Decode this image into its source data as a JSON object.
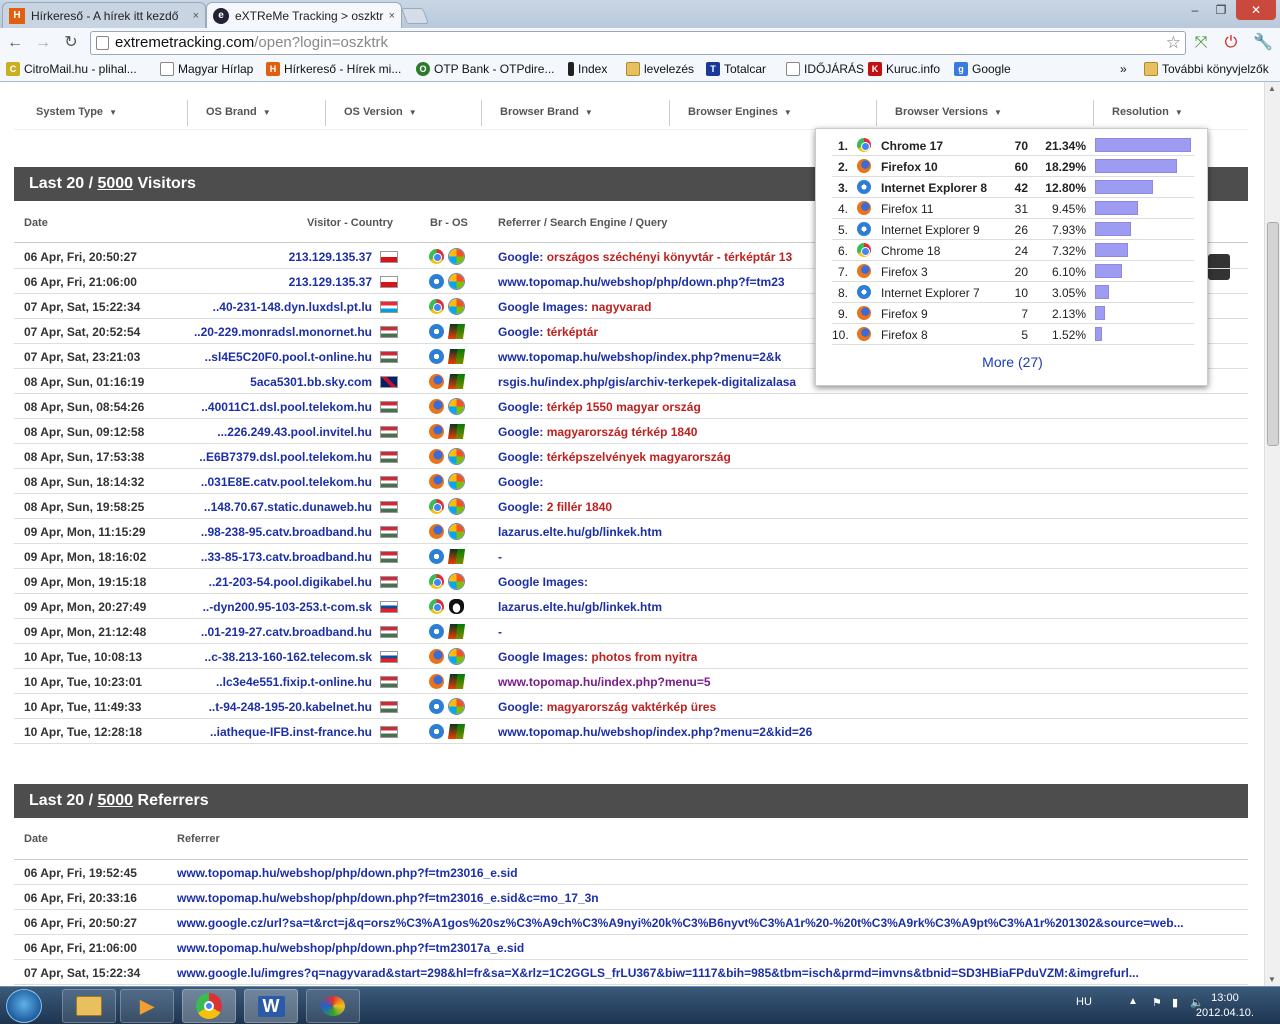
{
  "browser": {
    "tabs": [
      {
        "title": "Hírkereső - A hírek itt kezdő",
        "close": "×"
      },
      {
        "title": "eXTReMe Tracking > oszktr",
        "close": "×"
      }
    ],
    "window_controls": [
      "–",
      "❐",
      "✕"
    ],
    "url_host": "extremetracking.com",
    "url_path": "/open?login=oszktrk",
    "bookmarks": [
      {
        "label": "CitroMail.hu - plihal..."
      },
      {
        "label": "Magyar Hírlap"
      },
      {
        "label": "Hírkereső - Hírek mi..."
      },
      {
        "label": "OTP Bank - OTPdire..."
      },
      {
        "label": "Index"
      },
      {
        "label": "levelezés"
      },
      {
        "label": "Totalcar"
      },
      {
        "label": "IDŐJÁRÁS"
      },
      {
        "label": "Kuruc.info"
      },
      {
        "label": "Google"
      },
      {
        "label": "»"
      },
      {
        "label": "További könyvjelzők"
      }
    ]
  },
  "filters": [
    {
      "label": "System Type"
    },
    {
      "label": "OS Brand"
    },
    {
      "label": "OS Version"
    },
    {
      "label": "Browser Brand"
    },
    {
      "label": "Browser Engines"
    },
    {
      "label": "Browser Versions"
    },
    {
      "label": "Resolution"
    }
  ],
  "visitors": {
    "head_prefix": "Last 20 / ",
    "head_count": "5000",
    "head_suffix": " Visitors",
    "col_date": "Date",
    "col_visitor": "Visitor - Country",
    "col_bros": "Br - OS",
    "col_ref": "Referrer / Search Engine / Query",
    "rows": [
      {
        "date": "06 Apr, Fri, 20:50:27",
        "host": "213.129.135.37",
        "flag": "cz",
        "browser": "chrome",
        "os": "win7",
        "ref_a": "Google",
        "ref_b": ": ",
        "ref_q": "országos széchényi könyvtár - térképtár 13"
      },
      {
        "date": "06 Apr, Fri, 21:06:00",
        "host": "213.129.135.37",
        "flag": "cz",
        "browser": "ie",
        "os": "win7",
        "ref_a": "www.topomap.hu/webshop/php/down.php?f=tm23",
        "ref_b": "",
        "ref_q": ""
      },
      {
        "date": "07 Apr, Sat, 15:22:34",
        "host": "..40-231-148.dyn.luxdsl.pt.lu",
        "flag": "lu",
        "browser": "chrome",
        "os": "win7",
        "ref_a": "Google Images",
        "ref_b": ": ",
        "ref_q": "nagyvarad"
      },
      {
        "date": "07 Apr, Sat, 20:52:54",
        "host": "..20-229.monradsl.monornet.hu",
        "flag": "hu",
        "browser": "ie",
        "os": "xp",
        "ref_a": "Google",
        "ref_b": ": ",
        "ref_q": "térképtár"
      },
      {
        "date": "07 Apr, Sat, 23:21:03",
        "host": "..sl4E5C20F0.pool.t-online.hu",
        "flag": "hu",
        "browser": "ie",
        "os": "xp",
        "ref_a": "www.topomap.hu/webshop/index.php?menu=2&k",
        "ref_b": "",
        "ref_q": ""
      },
      {
        "date": "08 Apr, Sun, 01:16:19",
        "host": "5aca5301.bb.sky.com",
        "flag": "gb",
        "browser": "ff",
        "os": "xp",
        "ref_a": "rsgis.hu/index.php/gis/archiv-terkepek-digitalizalasa",
        "ref_b": "",
        "ref_q": ""
      },
      {
        "date": "08 Apr, Sun, 08:54:26",
        "host": "..40011C1.dsl.pool.telekom.hu",
        "flag": "hu",
        "browser": "ff",
        "os": "win7",
        "ref_a": "Google",
        "ref_b": ": ",
        "ref_q": "térkép 1550 magyar ország"
      },
      {
        "date": "08 Apr, Sun, 09:12:58",
        "host": "...226.249.43.pool.invitel.hu",
        "flag": "hu",
        "browser": "ff",
        "os": "xp",
        "ref_a": "Google",
        "ref_b": ": ",
        "ref_q": "magyarország térkép 1840"
      },
      {
        "date": "08 Apr, Sun, 17:53:38",
        "host": "..E6B7379.dsl.pool.telekom.hu",
        "flag": "hu",
        "browser": "ff",
        "os": "win7",
        "ref_a": "Google",
        "ref_b": ": ",
        "ref_q": "térképszelvények magyarország"
      },
      {
        "date": "08 Apr, Sun, 18:14:32",
        "host": "..031E8E.catv.pool.telekom.hu",
        "flag": "hu",
        "browser": "ff",
        "os": "win7",
        "ref_a": "Google",
        "ref_b": ":",
        "ref_q": ""
      },
      {
        "date": "08 Apr, Sun, 19:58:25",
        "host": "..148.70.67.static.dunaweb.hu",
        "flag": "hu",
        "browser": "chrome",
        "os": "win7",
        "ref_a": "Google",
        "ref_b": ": ",
        "ref_q": "2 fillér 1840"
      },
      {
        "date": "09 Apr, Mon, 11:15:29",
        "host": "..98-238-95.catv.broadband.hu",
        "flag": "hu",
        "browser": "ff",
        "os": "win7",
        "ref_a": "lazarus.elte.hu/gb/linkek.htm",
        "ref_b": "",
        "ref_q": ""
      },
      {
        "date": "09 Apr, Mon, 18:16:02",
        "host": "..33-85-173.catv.broadband.hu",
        "flag": "hu",
        "browser": "ie",
        "os": "xp",
        "ref_a": "",
        "ref_b": "-",
        "ref_q": ""
      },
      {
        "date": "09 Apr, Mon, 19:15:18",
        "host": "..21-203-54.pool.digikabel.hu",
        "flag": "hu",
        "browser": "chrome",
        "os": "win7",
        "ref_a": "Google Images",
        "ref_b": ":",
        "ref_q": ""
      },
      {
        "date": "09 Apr, Mon, 20:27:49",
        "host": "..-dyn200.95-103-253.t-com.sk",
        "flag": "sk",
        "browser": "chrome",
        "os": "linux",
        "ref_a": "lazarus.elte.hu/gb/linkek.htm",
        "ref_b": "",
        "ref_q": ""
      },
      {
        "date": "09 Apr, Mon, 21:12:48",
        "host": "..01-219-27.catv.broadband.hu",
        "flag": "hu",
        "browser": "ie",
        "os": "xp",
        "ref_a": "",
        "ref_b": "-",
        "ref_q": ""
      },
      {
        "date": "10 Apr, Tue, 10:08:13",
        "host": "..c-38.213-160-162.telecom.sk",
        "flag": "sk",
        "browser": "ff",
        "os": "win7",
        "ref_a": "Google Images",
        "ref_b": ": ",
        "ref_q": "photos from nyitra"
      },
      {
        "date": "10 Apr, Tue, 10:23:01",
        "host": "..lc3e4e551.fixip.t-online.hu",
        "flag": "hu",
        "browser": "ff",
        "os": "xp",
        "ref_v": "www.topomap.hu/index.php?menu=5",
        "ref_a": "",
        "ref_b": "",
        "ref_q": ""
      },
      {
        "date": "10 Apr, Tue, 11:49:33",
        "host": "..t-94-248-195-20.kabelnet.hu",
        "flag": "hu",
        "browser": "ie",
        "os": "win7",
        "ref_a": "Google",
        "ref_b": ": ",
        "ref_q": "magyarország vaktérkép üres"
      },
      {
        "date": "10 Apr, Tue, 12:28:18",
        "host": "..iatheque-IFB.inst-france.hu",
        "flag": "hu",
        "browser": "ie",
        "os": "xp",
        "ref_a": "www.topomap.hu/webshop/index.php?menu=2&kid=26",
        "ref_b": "",
        "ref_q": ""
      }
    ]
  },
  "referrers": {
    "head_prefix": "Last 20 / ",
    "head_count": "5000",
    "head_suffix": " Referrers",
    "col_date": "Date",
    "col_ref": "Referrer",
    "rows": [
      {
        "date": "06 Apr, Fri, 19:52:45",
        "ref": "www.topomap.hu/webshop/php/down.php?f=tm23016_e.sid"
      },
      {
        "date": "06 Apr, Fri, 20:33:16",
        "ref": "www.topomap.hu/webshop/php/down.php?f=tm23016_e.sid&c=mo_17_3n"
      },
      {
        "date": "06 Apr, Fri, 20:50:27",
        "ref": "www.google.cz/url?sa=t&rct=j&q=orsz%C3%A1gos%20sz%C3%A9ch%C3%A9nyi%20k%C3%B6nyvt%C3%A1r%20-%20t%C3%A9rk%C3%A9pt%C3%A1r%201302&source=web..."
      },
      {
        "date": "06 Apr, Fri, 21:06:00",
        "ref": "www.topomap.hu/webshop/php/down.php?f=tm23017a_e.sid"
      },
      {
        "date": "07 Apr, Sat, 15:22:34",
        "ref": "www.google.lu/imgres?q=nagyvarad&start=298&hl=fr&sa=X&rlz=1C2GGLS_frLU367&biw=1117&bih=985&tbm=isch&prmd=imvns&tbnid=SD3HBiaFPduVZM:&imgrefurl..."
      }
    ]
  },
  "browser_versions_popup": {
    "more_label": "More (27)",
    "items": [
      {
        "rank": "1.",
        "name": "Chrome 17",
        "count": "70",
        "pct": "21.34%",
        "frac": 0.2134,
        "icon": "chrome",
        "bold": true
      },
      {
        "rank": "2.",
        "name": "Firefox 10",
        "count": "60",
        "pct": "18.29%",
        "frac": 0.1829,
        "icon": "ff",
        "bold": true
      },
      {
        "rank": "3.",
        "name": "Internet Explorer 8",
        "count": "42",
        "pct": "12.80%",
        "frac": 0.128,
        "icon": "ie",
        "bold": true
      },
      {
        "rank": "4.",
        "name": "Firefox 11",
        "count": "31",
        "pct": "9.45%",
        "frac": 0.0945,
        "icon": "ff",
        "bold": false
      },
      {
        "rank": "5.",
        "name": "Internet Explorer 9",
        "count": "26",
        "pct": "7.93%",
        "frac": 0.0793,
        "icon": "ie",
        "bold": false
      },
      {
        "rank": "6.",
        "name": "Chrome 18",
        "count": "24",
        "pct": "7.32%",
        "frac": 0.0732,
        "icon": "chrome",
        "bold": false
      },
      {
        "rank": "7.",
        "name": "Firefox 3",
        "count": "20",
        "pct": "6.10%",
        "frac": 0.061,
        "icon": "ff",
        "bold": false
      },
      {
        "rank": "8.",
        "name": "Internet Explorer 7",
        "count": "10",
        "pct": "3.05%",
        "frac": 0.0305,
        "icon": "ie",
        "bold": false
      },
      {
        "rank": "9.",
        "name": "Firefox 9",
        "count": "7",
        "pct": "2.13%",
        "frac": 0.0213,
        "icon": "ff",
        "bold": false
      },
      {
        "rank": "10.",
        "name": "Firefox 8",
        "count": "5",
        "pct": "1.52%",
        "frac": 0.0152,
        "icon": "ff",
        "bold": false
      }
    ]
  },
  "taskbar": {
    "lang": "HU",
    "time": "13:00",
    "date": "2012.04.10.",
    "word_label": "W"
  }
}
